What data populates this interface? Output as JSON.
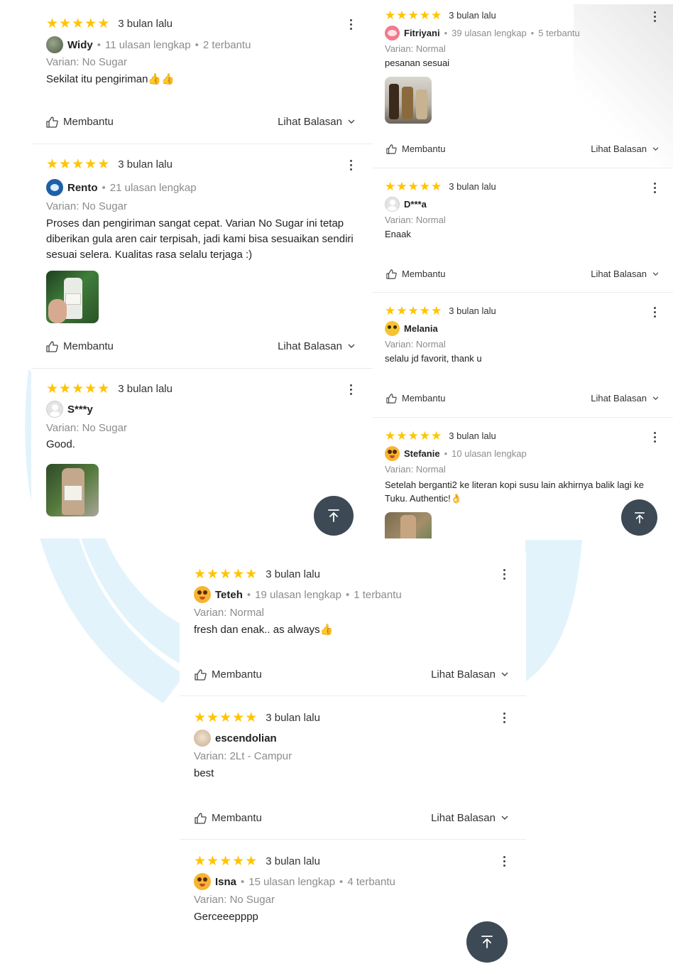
{
  "ui": {
    "helpful_label": "Membantu",
    "replies_label": "Lihat Balasan",
    "scroll_top_icon": "arrow-up-to-line-icon",
    "star_color": "#ffc400",
    "fab_color": "#3d4a55",
    "watermark_color": "#e3f3fb"
  },
  "panel_a": {
    "reviews": [
      {
        "rating": 5,
        "time": "3 bulan lalu",
        "user": "Widy",
        "meta1": "11 ulasan lengkap",
        "meta2": "2 terbantu",
        "variant": "Varian: No Sugar",
        "text": "Sekilat itu pengiriman👍👍"
      },
      {
        "rating": 5,
        "time": "3 bulan lalu",
        "user": "Rento",
        "meta1": "21 ulasan lengkap",
        "variant": "Varian: No Sugar",
        "text": "Proses dan pengiriman sangat cepat. Varian No Sugar ini tetap diberikan gula aren cair terpisah, jadi kami bisa sesuaikan sendiri sesuai selera. Kualitas rasa selalu terjaga :)"
      },
      {
        "rating": 5,
        "time": "3 bulan lalu",
        "user": "S***y",
        "variant": "Varian: No Sugar",
        "text": "Good."
      }
    ]
  },
  "panel_b": {
    "reviews": [
      {
        "rating": 5,
        "time": "3 bulan lalu",
        "user": "Fitriyani",
        "meta1": "39 ulasan lengkap",
        "meta2": "5 terbantu",
        "variant": "Varian: Normal",
        "text": "pesanan sesuai"
      },
      {
        "rating": 5,
        "time": "3 bulan lalu",
        "user": "D***a",
        "variant": "Varian: Normal",
        "text": "Enaak"
      },
      {
        "rating": 5,
        "time": "3 bulan lalu",
        "user": "Melania",
        "variant": "Varian: Normal",
        "text": "selalu jd favorit, thank u"
      },
      {
        "rating": 5,
        "time": "3 bulan lalu",
        "user": "Stefanie",
        "meta1": "10 ulasan lengkap",
        "variant": "Varian: Normal",
        "text": "Setelah berganti2 ke literan kopi susu lain akhirnya balik lagi ke Tuku. Authentic!👌"
      }
    ]
  },
  "panel_c": {
    "reviews": [
      {
        "rating": 5,
        "time": "3 bulan lalu",
        "user": "Teteh",
        "meta1": "19 ulasan lengkap",
        "meta2": "1 terbantu",
        "variant": "Varian: Normal",
        "text": "fresh dan enak.. as always👍"
      },
      {
        "rating": 5,
        "time": "3 bulan lalu",
        "user": "escendolian",
        "variant": "Varian: 2Lt - Campur",
        "text": "best"
      },
      {
        "rating": 5,
        "time": "3 bulan lalu",
        "user": "Isna",
        "meta1": "15 ulasan lengkap",
        "meta2": "4 terbantu",
        "variant": "Varian: No Sugar",
        "text": "Gerceeepppp"
      }
    ]
  }
}
